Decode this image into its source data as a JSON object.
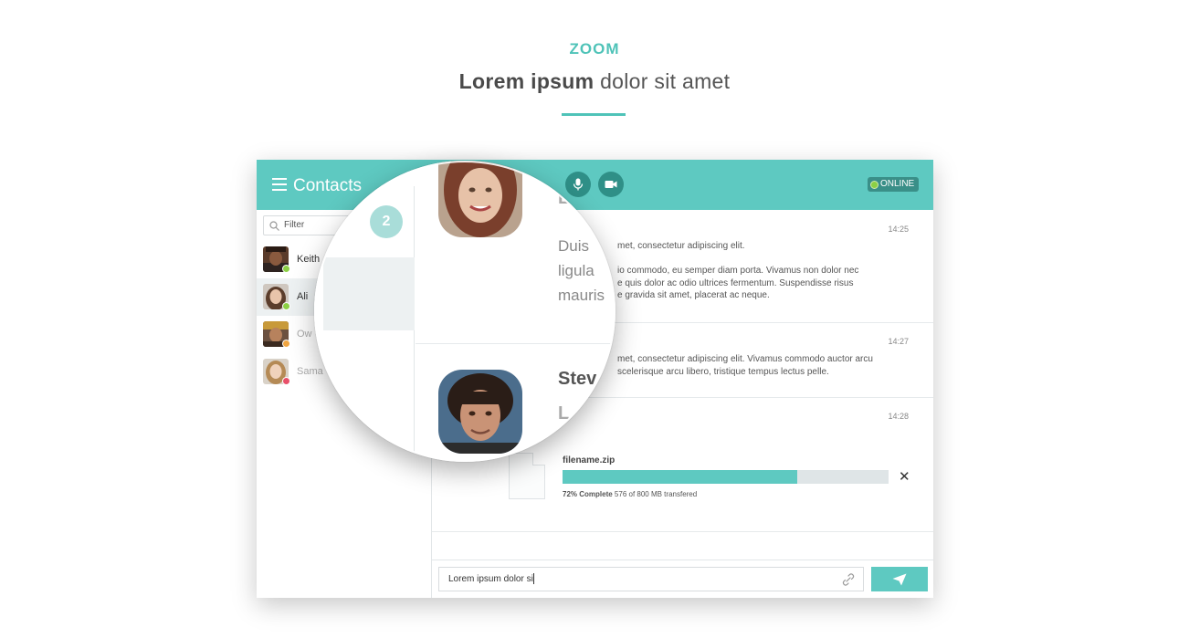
{
  "hero": {
    "eyebrow": "ZOOM",
    "headline_bold": "Lorem ipsum",
    "headline_rest": "dolor sit amet"
  },
  "header": {
    "title": "Contacts",
    "status": "ONLINE"
  },
  "sidebar": {
    "filter_placeholder": "Filter",
    "contacts": [
      {
        "name": "Keith",
        "presence": "online",
        "presence_color": "#8cd045"
      },
      {
        "name": "Ali",
        "presence": "online",
        "presence_color": "#8cd045"
      },
      {
        "name": "Ow",
        "presence": "away",
        "presence_color": "#f0a541"
      },
      {
        "name": "Sama",
        "presence": "busy",
        "presence_color": "#e8506a"
      }
    ]
  },
  "messages": [
    {
      "time": "14:25",
      "lines": [
        "met, consectetur adipiscing elit.",
        "",
        "io commodo, eu semper diam porta. Vivamus non dolor nec",
        "e quis dolor ac odio ultrices fermentum. Suspendisse risus",
        "e gravida sit amet, placerat ac neque."
      ]
    },
    {
      "time": "14:27",
      "lines": [
        "met, consectetur adipiscing elit. Vivamus commodo auctor arcu",
        "scelerisque arcu libero, tristique tempus lectus pelle."
      ]
    },
    {
      "time": "14:28",
      "file": {
        "name": "filename.zip",
        "progress_percent": 72,
        "complete_label": "72% Complete",
        "detail": "576 of 800 MB transfered",
        "cancel": "✕"
      }
    }
  ],
  "composer": {
    "value": "Lorem ipsum dolor si"
  },
  "zoom": {
    "badge": "2",
    "text_lines": [
      "Duis",
      "ligula",
      "mauris"
    ],
    "name": "Stev",
    "mark_top": "L",
    "mark_bottom": "L"
  },
  "colors": {
    "accent": "#5ec9c1",
    "accent_dark": "#2f8f87",
    "online": "#8cd045"
  },
  "icons": [
    "menu-icon",
    "microphone-icon",
    "video-camera-icon",
    "search-icon",
    "paperclip-icon",
    "send-icon",
    "close-icon",
    "file-icon"
  ]
}
